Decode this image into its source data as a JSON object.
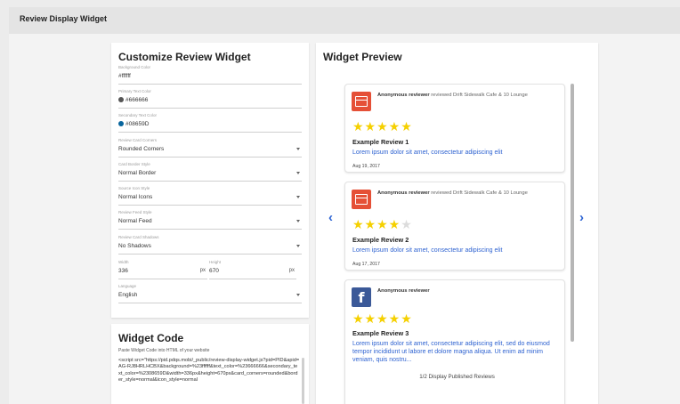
{
  "app": {
    "title": "Review Display Widget"
  },
  "customize": {
    "title": "Customize Review Widget",
    "fields": [
      {
        "label": "Background Color",
        "value": "#ffffff"
      },
      {
        "label": "Primary Text Color",
        "value": "#666666",
        "swatch": "#555555"
      },
      {
        "label": "Secondary Text Color",
        "value": "#08659D",
        "swatch": "#08659D"
      },
      {
        "label": "Review Card Corners",
        "value": "Rounded Corners"
      },
      {
        "label": "Card Border Style",
        "value": "Normal Border"
      },
      {
        "label": "Source Icon Style",
        "value": "Normal Icons"
      },
      {
        "label": "Review Feed Style",
        "value": "Normal Feed"
      },
      {
        "label": "Review Card Shadows",
        "value": "No Shadows"
      }
    ],
    "width": {
      "label": "Width",
      "value": "336",
      "unit": "px"
    },
    "height": {
      "label": "Height",
      "value": "670",
      "unit": "px"
    },
    "language": {
      "label": "Language",
      "value": "English"
    }
  },
  "code": {
    "title": "Widget Code",
    "subtitle": "Paste Widget Code into HTML of your website",
    "snippet": "<script src=\"https://pid.pdqs.mobi/_public/review-display-widget.js?pid=PID&apid=AG-RJ8HRLHCBX&background=%23ffffff&text_color=%23666666&secondary_text_color=%2308659D&width=336px&height=670px&card_corners=rounded&border_style=normal&icon_style=normal"
  },
  "preview": {
    "title": "Widget Preview",
    "reviews": [
      {
        "reviewer": "Anonymous reviewer",
        "action": " reviewed Drift Sidewalk Cafe & 10 Lounge",
        "rating": 5,
        "title": "Example Review 1",
        "body": "Lorem ipsum dolor sit amet, consectetur adipiscing elit",
        "date": "Aug 19, 2017",
        "source_icon": "restaurant-icon"
      },
      {
        "reviewer": "Anonymous reviewer",
        "action": " reviewed Drift Sidewalk Cafe & 10 Lounge",
        "rating": 4,
        "title": "Example Review 2",
        "body": "Lorem ipsum dolor sit amet, consectetur adipiscing elit",
        "date": "Aug 17, 2017",
        "source_icon": "restaurant-icon"
      },
      {
        "reviewer": "Anonymous reviewer",
        "action": "",
        "rating": 5,
        "title": "Example Review 3",
        "body": "Lorem ipsum dolor sit amet, consectetur adipiscing elit, sed do eiusmod tempor incididunt ut labore et dolore magna aliqua. Ut enim ad minim veniam, quis nostru...",
        "date": "",
        "source_icon": "facebook-icon"
      }
    ],
    "page_info": "1/2  Display Published Reviews",
    "prev_icon": "‹",
    "next_icon": "›"
  },
  "colors": {
    "star": "#f5d000",
    "link": "#2f63d1",
    "arrow": "#2a62d3"
  }
}
